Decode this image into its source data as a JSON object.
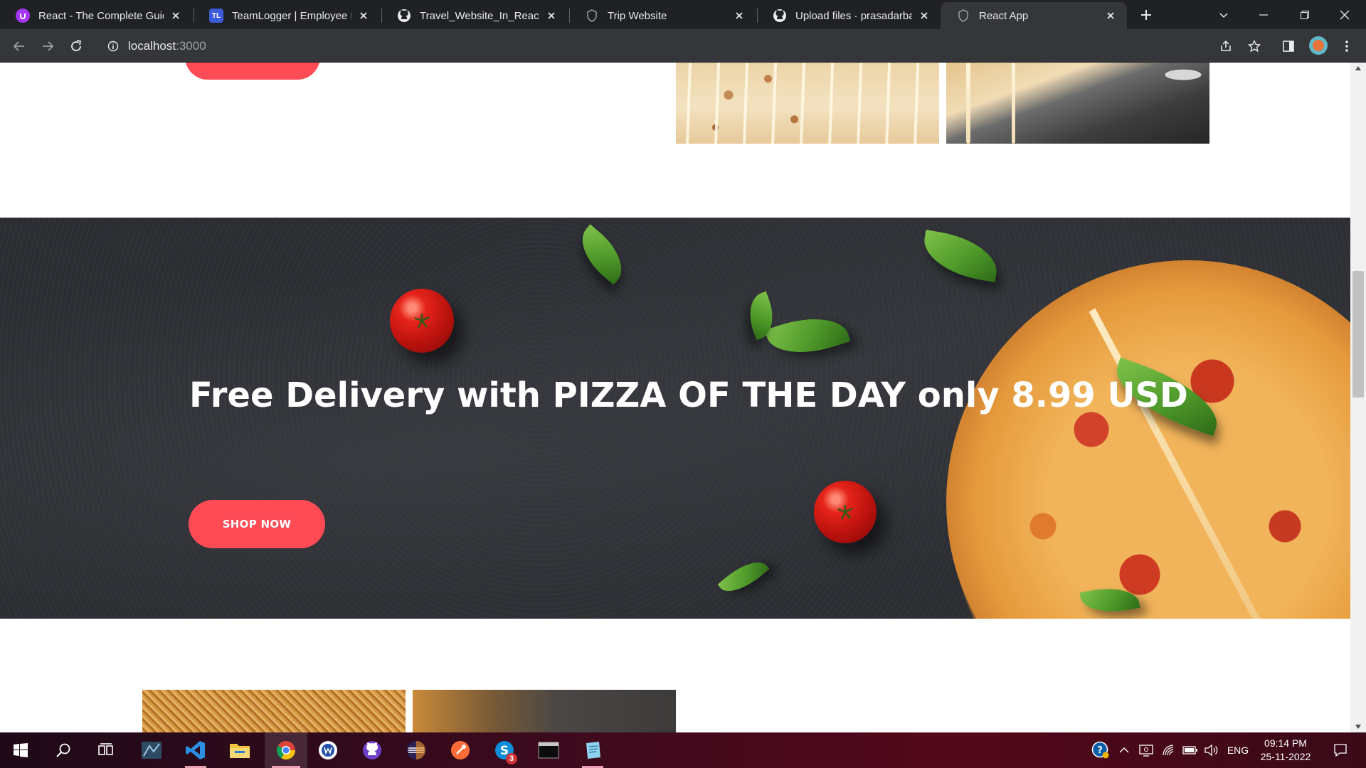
{
  "browser": {
    "tabs": [
      {
        "title": "React - The Complete Guide",
        "favicon": "udemy-icon",
        "active": false
      },
      {
        "title": "TeamLogger | Employee Monitoring",
        "favicon": "teamlogger-icon",
        "active": false
      },
      {
        "title": "Travel_Website_In_React/Sc",
        "favicon": "github-icon",
        "active": false
      },
      {
        "title": "Trip Website",
        "favicon": "react-icon",
        "active": false
      },
      {
        "title": "Upload files · prasadarbad/",
        "favicon": "github-icon",
        "active": false
      },
      {
        "title": "React App",
        "favicon": "react-icon",
        "active": true
      }
    ],
    "teamlogger_favicon_text": "TL",
    "address": {
      "host": "localhost",
      "port": ":3000"
    }
  },
  "page": {
    "banner": {
      "headline": "Free Delivery with PIZZA OF THE DAY only 8.99 USD",
      "cta_label": "SHOP NOW"
    },
    "colors": {
      "accent": "#ff4b55",
      "banner_bg": "#2d2f34"
    }
  },
  "taskbar": {
    "apps": [
      {
        "name": "windows-start",
        "running": false
      },
      {
        "name": "search",
        "running": false
      },
      {
        "name": "task-view",
        "running": false
      },
      {
        "name": "sql-server",
        "running": false
      },
      {
        "name": "vs-code",
        "running": true
      },
      {
        "name": "file-explorer",
        "running": false
      },
      {
        "name": "chrome",
        "running": true,
        "active": true
      },
      {
        "name": "word-app",
        "running": false
      },
      {
        "name": "github-desktop",
        "running": false
      },
      {
        "name": "eclipse",
        "running": false
      },
      {
        "name": "postman",
        "running": false
      },
      {
        "name": "skype",
        "running": false,
        "badge": "3"
      },
      {
        "name": "terminal",
        "running": false
      },
      {
        "name": "notepad",
        "running": true
      }
    ],
    "tray": {
      "language": "ENG",
      "time": "09:14 PM",
      "date": "25-11-2022"
    }
  }
}
